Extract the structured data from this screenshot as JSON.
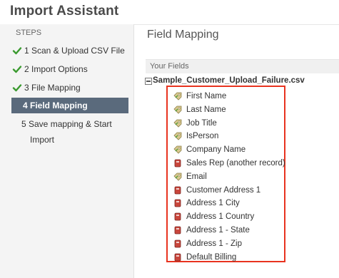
{
  "app": {
    "title": "Import Assistant"
  },
  "sidebar": {
    "heading": "STEPS",
    "steps": [
      {
        "label": "1 Scan & Upload CSV File",
        "state": "done"
      },
      {
        "label": "2 Import Options",
        "state": "done"
      },
      {
        "label": "3 File Mapping",
        "state": "done"
      },
      {
        "label": "4 Field Mapping",
        "state": "active"
      },
      {
        "label_line1": "5 Save mapping & Start",
        "label_line2": "Import",
        "state": "pending"
      }
    ]
  },
  "main": {
    "title": "Field Mapping",
    "section_label": "Your Fields",
    "file_name": "Sample_Customer_Upload_Failure.csv",
    "fields": [
      {
        "label": "First Name",
        "icon": "tag-icon"
      },
      {
        "label": "Last Name",
        "icon": "tag-icon"
      },
      {
        "label": "Job Title",
        "icon": "tag-icon"
      },
      {
        "label": "IsPerson",
        "icon": "tag-icon"
      },
      {
        "label": "Company Name",
        "icon": "tag-icon"
      },
      {
        "label": "Sales Rep (another record)",
        "icon": "record-icon"
      },
      {
        "label": "Email",
        "icon": "tag-icon"
      },
      {
        "label": "Customer Address 1",
        "icon": "record-icon"
      },
      {
        "label": "Address 1 City",
        "icon": "record-icon"
      },
      {
        "label": "Address 1 Country",
        "icon": "record-icon"
      },
      {
        "label": "Address 1 - State",
        "icon": "record-icon"
      },
      {
        "label": "Address 1 - Zip",
        "icon": "record-icon"
      },
      {
        "label": "Default Billing",
        "icon": "record-icon"
      }
    ]
  },
  "colors": {
    "active_step": "#5a6a7c",
    "highlight_border": "#e8331f",
    "check": "#3a9a2f"
  }
}
